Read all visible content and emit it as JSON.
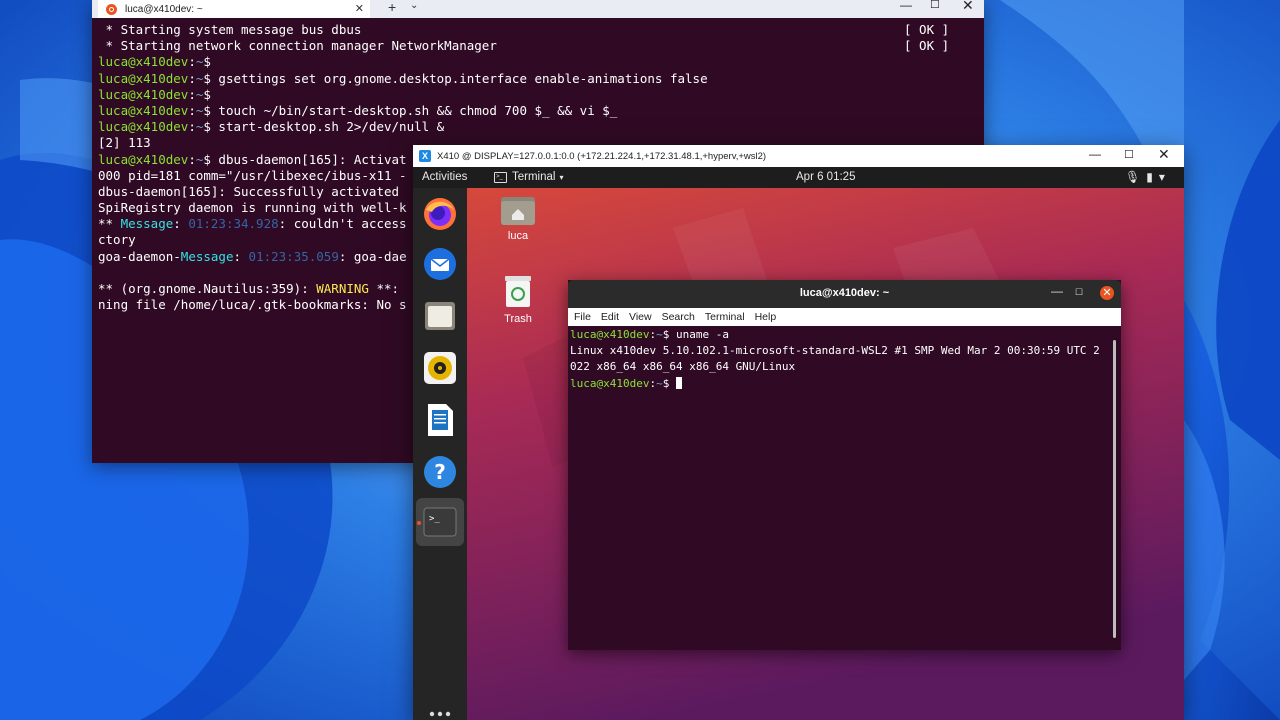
{
  "colors": {
    "ubuntu_orange": "#e95420",
    "terminal_bg": "#300a24",
    "prompt_green": "#8ae234",
    "path_blue": "#729fcf",
    "win_blue": "#0b58d8"
  },
  "windows_terminal": {
    "tab_title": "luca@x410dev: ~",
    "tab_close": "✕",
    "new_tab": "+",
    "dropdown": "⌄",
    "minimize": "—",
    "maximize": "☐",
    "close": "✕",
    "lines": [
      {
        "text": " * Starting system message bus dbus",
        "ok": "[ OK ]"
      },
      {
        "text": " * Starting network connection manager NetworkManager",
        "ok": "[ OK ]"
      },
      {
        "user": "luca@x410dev",
        "path": "~",
        "cmd": ""
      },
      {
        "user": "luca@x410dev",
        "path": "~",
        "cmd": " gsettings set org.gnome.desktop.interface enable-animations false"
      },
      {
        "user": "luca@x410dev",
        "path": "~",
        "cmd": ""
      },
      {
        "user": "luca@x410dev",
        "path": "~",
        "cmd": " touch ~/bin/start-desktop.sh && chmod 700 $_ && vi $_"
      },
      {
        "user": "luca@x410dev",
        "path": "~",
        "cmd": " start-desktop.sh 2>/dev/null &"
      },
      {
        "text": "[2] 113"
      },
      {
        "user": "luca@x410dev",
        "path": "~",
        "cmd": " dbus-daemon[165]: Activat"
      },
      {
        "text": "000 pid=181 comm=\"/usr/libexec/ibus-x11 -"
      },
      {
        "text": "dbus-daemon[165]: Successfully activated"
      },
      {
        "text": "SpiRegistry daemon is running with well-k"
      },
      {
        "prefix": "** ",
        "label": "Message",
        "time": "01:23:34.928",
        "rest": ": couldn't access"
      },
      {
        "text": "ctory"
      },
      {
        "prefix": "goa-daemon-",
        "label": "Message",
        "time": "01:23:35.059",
        "rest": ": goa-dae"
      },
      {
        "text": ""
      },
      {
        "prefix": "** (org.gnome.Nautilus:359): ",
        "warn": "WARNING",
        "rest": " **:"
      },
      {
        "text": "ning file /home/luca/.gtk-bookmarks: No s"
      }
    ]
  },
  "x410": {
    "title": "X410 @ DISPLAY=127.0.0.1:0.0 (+172.21.224.1,+172.31.48.1,+hyperv,+wsl2)",
    "logo": "X",
    "minimize": "—",
    "maximize": "☐",
    "close": "✕",
    "topbar": {
      "activities": "Activities",
      "app_menu": "Terminal",
      "app_caret": "▾",
      "clock": "Apr 6  01:25",
      "tray_mic": "🎙",
      "tray_battery": "▮",
      "tray_caret": "▾"
    },
    "desktop_icons": {
      "home_label": "luca",
      "trash_label": "Trash"
    },
    "gnome_terminal": {
      "title": "luca@x410dev: ~",
      "minimize": "—",
      "maximize": "☐",
      "close": "✕",
      "menu": [
        "File",
        "Edit",
        "View",
        "Search",
        "Terminal",
        "Help"
      ],
      "lines": [
        {
          "user": "luca@x410dev",
          "path": "~",
          "cmd": " uname -a"
        },
        {
          "text": "Linux x410dev 5.10.102.1-microsoft-standard-WSL2 #1 SMP Wed Mar 2 00:30:59 UTC 2"
        },
        {
          "text": "022 x86_64 x86_64 x86_64 GNU/Linux"
        },
        {
          "user": "luca@x410dev",
          "path": "~",
          "cmd": " ",
          "cursor": true
        }
      ]
    }
  }
}
